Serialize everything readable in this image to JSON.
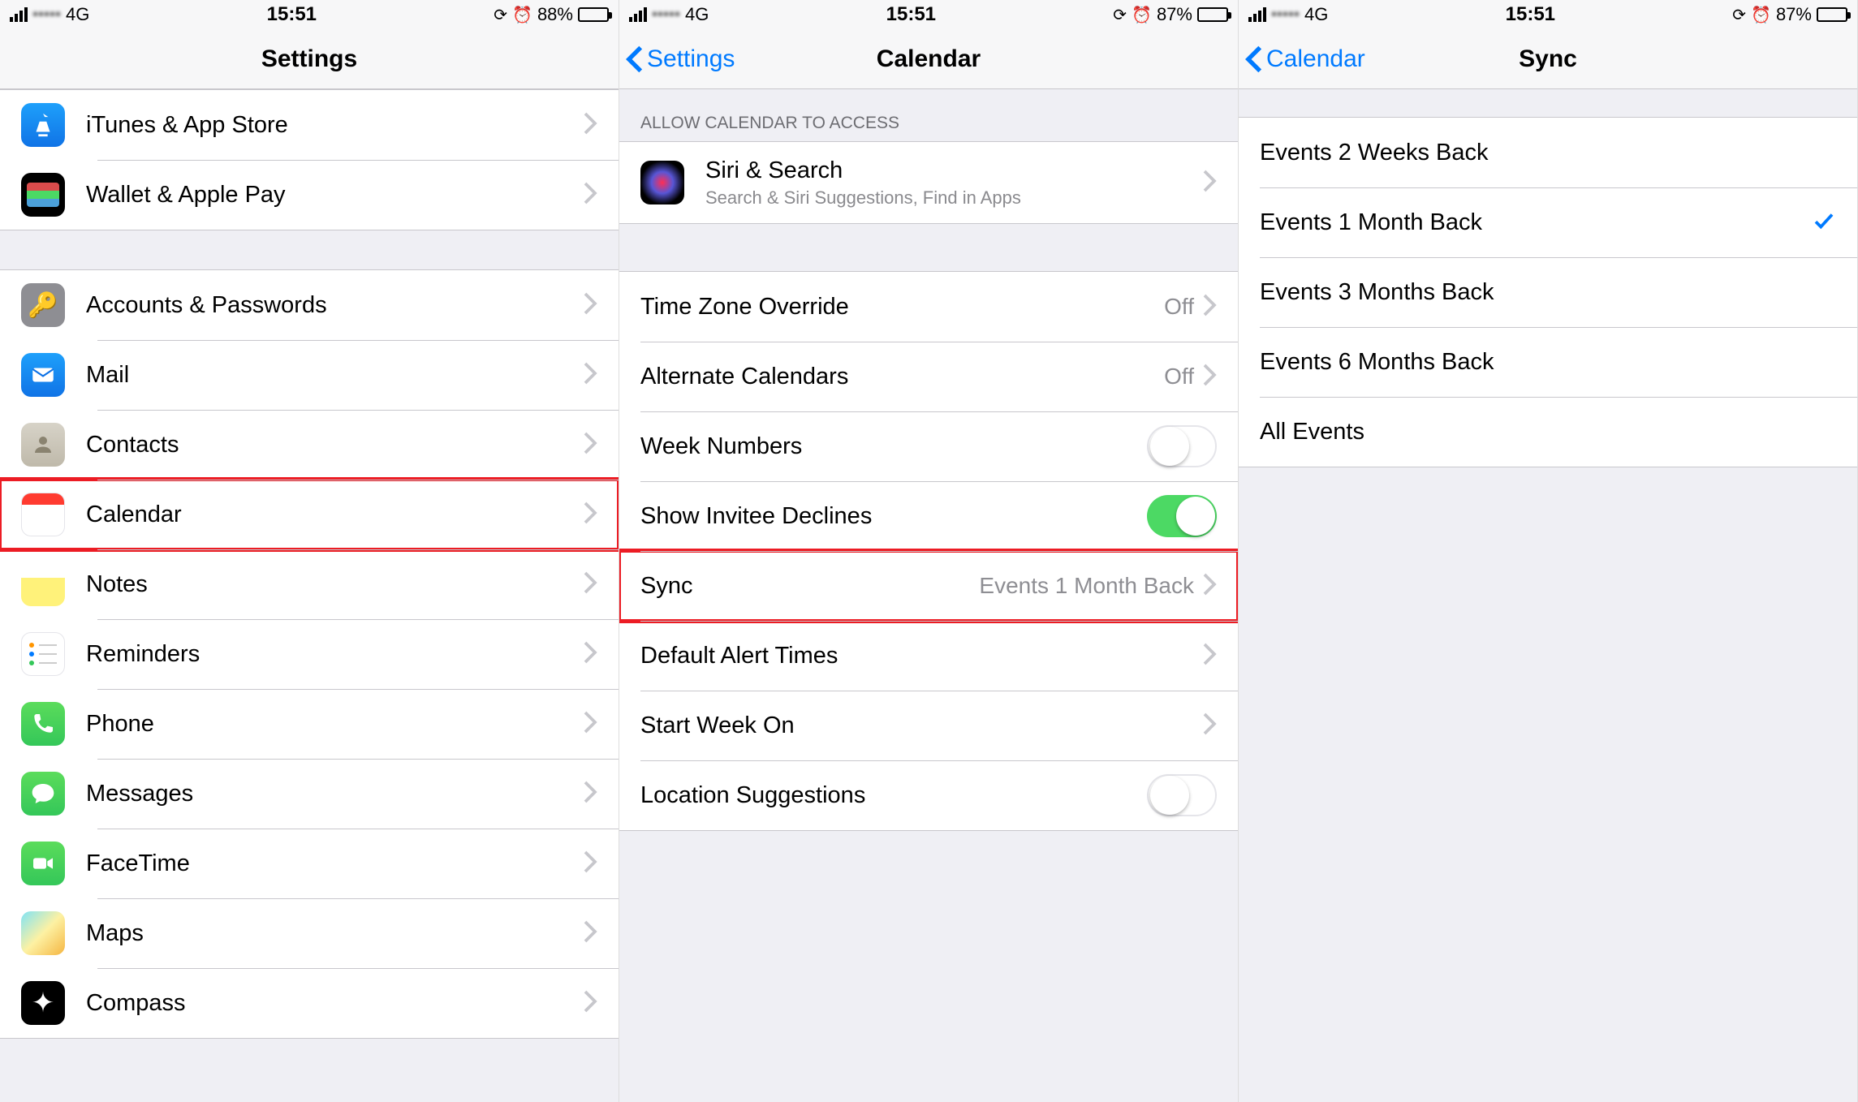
{
  "screens": [
    {
      "status": {
        "carrier_obscured": "•••••",
        "network": "4G",
        "time": "15:51",
        "battery_pct": "88%",
        "battery_level": 0.88
      },
      "nav": {
        "title": "Settings",
        "back": null
      },
      "groups": [
        {
          "rows": [
            {
              "icon": "appstore",
              "label": "iTunes & App Store"
            },
            {
              "icon": "wallet",
              "label": "Wallet & Apple Pay"
            }
          ]
        },
        {
          "rows": [
            {
              "icon": "accounts",
              "label": "Accounts & Passwords"
            },
            {
              "icon": "mail",
              "label": "Mail"
            },
            {
              "icon": "contacts",
              "label": "Contacts"
            },
            {
              "icon": "calendar",
              "label": "Calendar",
              "highlighted": true
            },
            {
              "icon": "notes",
              "label": "Notes"
            },
            {
              "icon": "reminders",
              "label": "Reminders"
            },
            {
              "icon": "phone",
              "label": "Phone"
            },
            {
              "icon": "messages",
              "label": "Messages"
            },
            {
              "icon": "facetime",
              "label": "FaceTime"
            },
            {
              "icon": "maps",
              "label": "Maps"
            },
            {
              "icon": "compass",
              "label": "Compass"
            }
          ]
        }
      ]
    },
    {
      "status": {
        "carrier_obscured": "•••••",
        "network": "4G",
        "time": "15:51",
        "battery_pct": "87%",
        "battery_level": 0.87
      },
      "nav": {
        "title": "Calendar",
        "back": "Settings"
      },
      "section_header": "ALLOW CALENDAR TO ACCESS",
      "siri_row": {
        "icon": "siri",
        "label": "Siri & Search",
        "subtitle": "Search & Siri Suggestions, Find in Apps"
      },
      "rows": [
        {
          "label": "Time Zone Override",
          "detail": "Off",
          "type": "disclosure"
        },
        {
          "label": "Alternate Calendars",
          "detail": "Off",
          "type": "disclosure"
        },
        {
          "label": "Week Numbers",
          "type": "toggle",
          "on": false
        },
        {
          "label": "Show Invitee Declines",
          "type": "toggle",
          "on": true
        },
        {
          "label": "Sync",
          "detail": "Events 1 Month Back",
          "type": "disclosure",
          "highlighted": true
        },
        {
          "label": "Default Alert Times",
          "type": "disclosure"
        },
        {
          "label": "Start Week On",
          "type": "disclosure"
        },
        {
          "label": "Location Suggestions",
          "type": "toggle",
          "on": false
        }
      ]
    },
    {
      "status": {
        "carrier_obscured": "•••••",
        "network": "4G",
        "time": "15:51",
        "battery_pct": "87%",
        "battery_level": 0.87
      },
      "nav": {
        "title": "Sync",
        "back": "Calendar"
      },
      "options": [
        {
          "label": "Events 2 Weeks Back",
          "selected": false
        },
        {
          "label": "Events 1 Month Back",
          "selected": true
        },
        {
          "label": "Events 3 Months Back",
          "selected": false
        },
        {
          "label": "Events 6 Months Back",
          "selected": false
        },
        {
          "label": "All Events",
          "selected": false
        }
      ]
    }
  ]
}
